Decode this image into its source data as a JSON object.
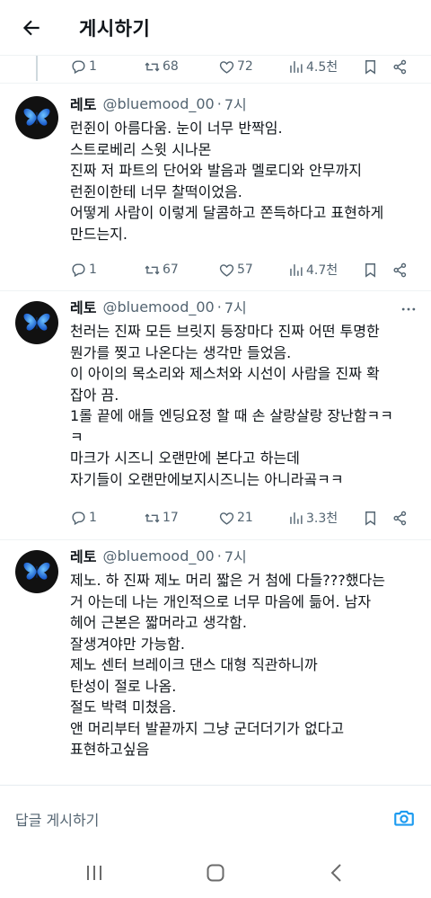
{
  "header": {
    "title": "게시하기"
  },
  "prev_tweet_actions": {
    "replies": "1",
    "retweets": "68",
    "likes": "72",
    "views": "4.5천"
  },
  "tweets": [
    {
      "name": "레토",
      "handle": "@bluemood_00",
      "dot": "·",
      "time": "7시",
      "lines": [
        "런쥔이 아름다움. 눈이 너무 반짝임.",
        "스트로베리 스윗 시나몬",
        "진짜 저 파트의 단어와 발음과 멜로디와 안무까지",
        "런쥔이한테 너무 찰떡이었음.",
        "어떻게 사람이 이렇게 달콤하고 쫀득하다고 표현하게",
        "만드는지."
      ],
      "replies": "1",
      "retweets": "67",
      "likes": "57",
      "views": "4.7천"
    },
    {
      "name": "레토",
      "handle": "@bluemood_00",
      "dot": "·",
      "time": "7시",
      "lines": [
        "천러는 진짜 모든 브릿지 등장마다 진짜 어떤 투명한",
        "뭔가를 찢고 나온다는 생각만 들었음.",
        "이 아이의 목소리와 제스처와 시선이 사람을 진짜 확",
        "잡아 끔.",
        "1롤 끝에 애들 엔딩요정 할 때 손 살랑살랑 장난함ㅋㅋ",
        "ㅋ",
        "마크가 시즈니 오랜만에 본다고 하는데",
        "자기들이 오랜만에보지시즈니는 아니라곸ㅋㅋ"
      ],
      "replies": "1",
      "retweets": "17",
      "likes": "21",
      "views": "3.3천"
    },
    {
      "name": "레토",
      "handle": "@bluemood_00",
      "dot": "·",
      "time": "7시",
      "lines": [
        "제노. 하 진짜 제노 머리 짧은 거 첨에 다들???했다는",
        "거 아는데 나는 개인적으로 너무 마음에 듦어. 남자",
        "헤어 근본은 짧머라고 생각함.",
        "잘생겨야만 가능함.",
        "제노 센터 브레이크 댄스 대형 직관하니까",
        "탄성이 절로 나옴.",
        "절도 박력 미쳤음.",
        "앤 머리부터 발끝까지 그냥 군더더기가 없다고",
        "표현하고싶음"
      ]
    }
  ],
  "reply_bar": {
    "placeholder": "답글 게시하기"
  },
  "icons": {
    "back": "back-arrow-icon",
    "reply": "reply-icon",
    "retweet": "retweet-icon",
    "like": "heart-icon",
    "views": "views-icon",
    "bookmark": "bookmark-icon",
    "share": "share-icon",
    "more": "more-icon",
    "camera": "camera-icon",
    "recent_apps": "recent-apps-icon",
    "home": "home-icon",
    "nav_back": "nav-back-icon"
  },
  "colors": {
    "text": "#0f1419",
    "secondary": "#536471",
    "accent": "#1d9bf0",
    "divider": "#eff3f4"
  }
}
